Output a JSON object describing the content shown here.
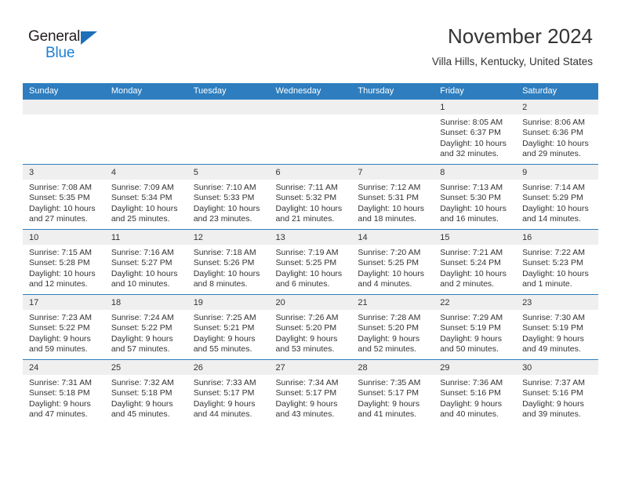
{
  "logo": {
    "word1": "General",
    "word2": "Blue",
    "triangle_color": "#1e6fb8",
    "blue_text_color": "#1b7fd4"
  },
  "header": {
    "title": "November 2024",
    "subtitle": "Villa Hills, Kentucky, United States"
  },
  "theme": {
    "header_blue": "#2e7ebf",
    "daynum_band": "#efefef",
    "text": "#333333"
  },
  "calendar": {
    "weekday_headers": [
      "Sunday",
      "Monday",
      "Tuesday",
      "Wednesday",
      "Thursday",
      "Friday",
      "Saturday"
    ],
    "weeks": [
      [
        {
          "day": "",
          "empty": true
        },
        {
          "day": "",
          "empty": true
        },
        {
          "day": "",
          "empty": true
        },
        {
          "day": "",
          "empty": true
        },
        {
          "day": "",
          "empty": true
        },
        {
          "day": "1",
          "sunrise": "Sunrise: 8:05 AM",
          "sunset": "Sunset: 6:37 PM",
          "daylight": "Daylight: 10 hours and 32 minutes."
        },
        {
          "day": "2",
          "sunrise": "Sunrise: 8:06 AM",
          "sunset": "Sunset: 6:36 PM",
          "daylight": "Daylight: 10 hours and 29 minutes."
        }
      ],
      [
        {
          "day": "3",
          "sunrise": "Sunrise: 7:08 AM",
          "sunset": "Sunset: 5:35 PM",
          "daylight": "Daylight: 10 hours and 27 minutes."
        },
        {
          "day": "4",
          "sunrise": "Sunrise: 7:09 AM",
          "sunset": "Sunset: 5:34 PM",
          "daylight": "Daylight: 10 hours and 25 minutes."
        },
        {
          "day": "5",
          "sunrise": "Sunrise: 7:10 AM",
          "sunset": "Sunset: 5:33 PM",
          "daylight": "Daylight: 10 hours and 23 minutes."
        },
        {
          "day": "6",
          "sunrise": "Sunrise: 7:11 AM",
          "sunset": "Sunset: 5:32 PM",
          "daylight": "Daylight: 10 hours and 21 minutes."
        },
        {
          "day": "7",
          "sunrise": "Sunrise: 7:12 AM",
          "sunset": "Sunset: 5:31 PM",
          "daylight": "Daylight: 10 hours and 18 minutes."
        },
        {
          "day": "8",
          "sunrise": "Sunrise: 7:13 AM",
          "sunset": "Sunset: 5:30 PM",
          "daylight": "Daylight: 10 hours and 16 minutes."
        },
        {
          "day": "9",
          "sunrise": "Sunrise: 7:14 AM",
          "sunset": "Sunset: 5:29 PM",
          "daylight": "Daylight: 10 hours and 14 minutes."
        }
      ],
      [
        {
          "day": "10",
          "sunrise": "Sunrise: 7:15 AM",
          "sunset": "Sunset: 5:28 PM",
          "daylight": "Daylight: 10 hours and 12 minutes."
        },
        {
          "day": "11",
          "sunrise": "Sunrise: 7:16 AM",
          "sunset": "Sunset: 5:27 PM",
          "daylight": "Daylight: 10 hours and 10 minutes."
        },
        {
          "day": "12",
          "sunrise": "Sunrise: 7:18 AM",
          "sunset": "Sunset: 5:26 PM",
          "daylight": "Daylight: 10 hours and 8 minutes."
        },
        {
          "day": "13",
          "sunrise": "Sunrise: 7:19 AM",
          "sunset": "Sunset: 5:25 PM",
          "daylight": "Daylight: 10 hours and 6 minutes."
        },
        {
          "day": "14",
          "sunrise": "Sunrise: 7:20 AM",
          "sunset": "Sunset: 5:25 PM",
          "daylight": "Daylight: 10 hours and 4 minutes."
        },
        {
          "day": "15",
          "sunrise": "Sunrise: 7:21 AM",
          "sunset": "Sunset: 5:24 PM",
          "daylight": "Daylight: 10 hours and 2 minutes."
        },
        {
          "day": "16",
          "sunrise": "Sunrise: 7:22 AM",
          "sunset": "Sunset: 5:23 PM",
          "daylight": "Daylight: 10 hours and 1 minute."
        }
      ],
      [
        {
          "day": "17",
          "sunrise": "Sunrise: 7:23 AM",
          "sunset": "Sunset: 5:22 PM",
          "daylight": "Daylight: 9 hours and 59 minutes."
        },
        {
          "day": "18",
          "sunrise": "Sunrise: 7:24 AM",
          "sunset": "Sunset: 5:22 PM",
          "daylight": "Daylight: 9 hours and 57 minutes."
        },
        {
          "day": "19",
          "sunrise": "Sunrise: 7:25 AM",
          "sunset": "Sunset: 5:21 PM",
          "daylight": "Daylight: 9 hours and 55 minutes."
        },
        {
          "day": "20",
          "sunrise": "Sunrise: 7:26 AM",
          "sunset": "Sunset: 5:20 PM",
          "daylight": "Daylight: 9 hours and 53 minutes."
        },
        {
          "day": "21",
          "sunrise": "Sunrise: 7:28 AM",
          "sunset": "Sunset: 5:20 PM",
          "daylight": "Daylight: 9 hours and 52 minutes."
        },
        {
          "day": "22",
          "sunrise": "Sunrise: 7:29 AM",
          "sunset": "Sunset: 5:19 PM",
          "daylight": "Daylight: 9 hours and 50 minutes."
        },
        {
          "day": "23",
          "sunrise": "Sunrise: 7:30 AM",
          "sunset": "Sunset: 5:19 PM",
          "daylight": "Daylight: 9 hours and 49 minutes."
        }
      ],
      [
        {
          "day": "24",
          "sunrise": "Sunrise: 7:31 AM",
          "sunset": "Sunset: 5:18 PM",
          "daylight": "Daylight: 9 hours and 47 minutes."
        },
        {
          "day": "25",
          "sunrise": "Sunrise: 7:32 AM",
          "sunset": "Sunset: 5:18 PM",
          "daylight": "Daylight: 9 hours and 45 minutes."
        },
        {
          "day": "26",
          "sunrise": "Sunrise: 7:33 AM",
          "sunset": "Sunset: 5:17 PM",
          "daylight": "Daylight: 9 hours and 44 minutes."
        },
        {
          "day": "27",
          "sunrise": "Sunrise: 7:34 AM",
          "sunset": "Sunset: 5:17 PM",
          "daylight": "Daylight: 9 hours and 43 minutes."
        },
        {
          "day": "28",
          "sunrise": "Sunrise: 7:35 AM",
          "sunset": "Sunset: 5:17 PM",
          "daylight": "Daylight: 9 hours and 41 minutes."
        },
        {
          "day": "29",
          "sunrise": "Sunrise: 7:36 AM",
          "sunset": "Sunset: 5:16 PM",
          "daylight": "Daylight: 9 hours and 40 minutes."
        },
        {
          "day": "30",
          "sunrise": "Sunrise: 7:37 AM",
          "sunset": "Sunset: 5:16 PM",
          "daylight": "Daylight: 9 hours and 39 minutes."
        }
      ]
    ]
  }
}
